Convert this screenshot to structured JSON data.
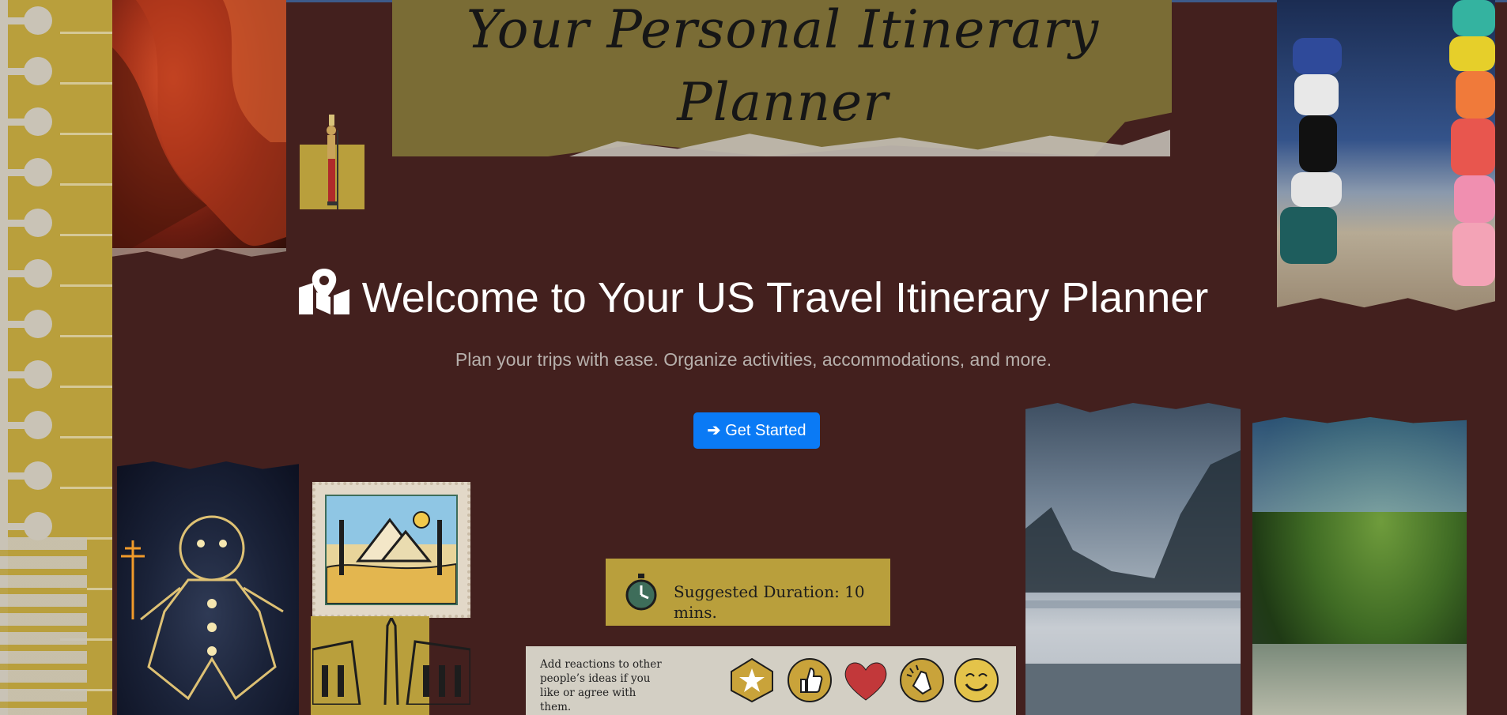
{
  "page": {
    "banner_title_line1": "Your Personal Itinerary",
    "banner_title_line2": "Planner"
  },
  "hero": {
    "icon": "map-marked-icon",
    "title": "Welcome to Your US Travel Itinerary Planner",
    "subtitle": "Plan your trips with ease. Organize activities, accommodations, and more.",
    "cta_label": "Get Started",
    "cta_icon": "arrow-right-icon"
  },
  "collage": {
    "duration_label": "Suggested Duration: 10 mins.",
    "reactions_text": "Add reactions to other people’s ideas if you like or agree with them.",
    "reaction_icons": [
      "star-icon",
      "thumbs-up-icon",
      "heart-icon",
      "clapping-icon",
      "smile-icon"
    ]
  },
  "colors": {
    "background": "#43201e",
    "accent_gold": "#b99f3c",
    "button_blue": "#0a7af5",
    "title_white": "#ffffff",
    "subtitle_gray": "#b7b0ac"
  }
}
